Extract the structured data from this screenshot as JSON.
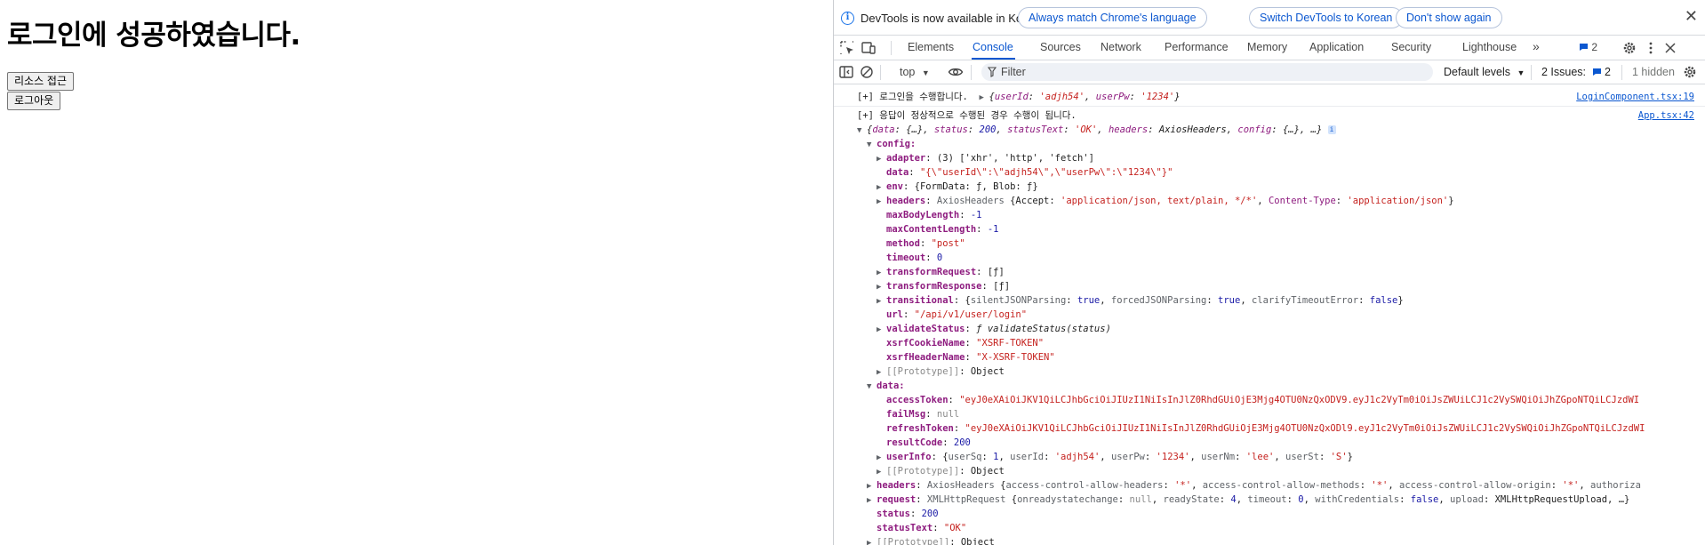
{
  "page": {
    "heading": "로그인에 성공하였습니다.",
    "resource_button": "리소스 접근",
    "logout_button": "로그아웃"
  },
  "infobar": {
    "message": "DevTools is now available in Korean!",
    "match_button": "Always match Chrome's language",
    "switch_button": "Switch DevTools to Korean",
    "dont_show_button": "Don't show again",
    "close_glyph": "✕"
  },
  "tabs": {
    "items": [
      "Elements",
      "Console",
      "Sources",
      "Network",
      "Performance",
      "Memory",
      "Application",
      "Security",
      "Lighthouse"
    ],
    "active": "Console",
    "more_glyph": "»",
    "issues_count": "2"
  },
  "filterbar": {
    "context": "top",
    "filter_placeholder": "Filter",
    "levels": "Default levels",
    "issues": "2 Issues:",
    "issues_count": "2",
    "hidden": "1 hidden"
  },
  "console": {
    "log1": {
      "prefix": "[+] 로그인을 수행합니다.",
      "obj_open": "{",
      "k1": "userId",
      "v1": "'adjh54'",
      "k2": "userPw",
      "v2": "'1234'",
      "obj_close": "}",
      "source": "LoginComponent.tsx:19"
    },
    "log2": {
      "prefix": "[+] 응답이 정상적으로 수행된 경우 수행이 됩니다.",
      "source": "App.tsx:42",
      "summary": {
        "data": "data",
        "data_v": "{…}",
        "status": "status",
        "status_v": "200",
        "statusText": "statusText",
        "statusText_v": "'OK'",
        "headers": "headers",
        "headers_v": "AxiosHeaders",
        "config": "config",
        "config_v": "{…}",
        "ellipsis": "…"
      },
      "config": {
        "label": "config:",
        "adapter_k": "adapter",
        "adapter_v": "(3) ['xhr', 'http', 'fetch']",
        "data_k": "data",
        "data_v": "\"{\\\"userId\\\":\\\"adjh54\\\",\\\"userPw\\\":\\\"1234\\\"}\"",
        "env_k": "env",
        "env_v": "{FormData: ƒ, Blob: ƒ}",
        "headers_k": "headers",
        "headers_cls": "AxiosHeaders",
        "headers_v1": "{Accept: ",
        "headers_accept": "'application/json, text/plain, */*'",
        "headers_ct_k": "Content-Type",
        "headers_ct": "'application/json'",
        "maxBodyLength_k": "maxBodyLength",
        "maxBodyLength_v": "-1",
        "maxContentLength_k": "maxContentLength",
        "maxContentLength_v": "-1",
        "method_k": "method",
        "method_v": "\"post\"",
        "timeout_k": "timeout",
        "timeout_v": "0",
        "transformRequest_k": "transformRequest",
        "transformRequest_v": "[ƒ]",
        "transformResponse_k": "transformResponse",
        "transformResponse_v": "[ƒ]",
        "transitional_k": "transitional",
        "tr_a_k": "silentJSONParsing",
        "tr_a_v": "true",
        "tr_b_k": "forcedJSONParsing",
        "tr_b_v": "true",
        "tr_c_k": "clarifyTimeoutError",
        "tr_c_v": "false",
        "url_k": "url",
        "url_v": "\"/api/v1/user/login\"",
        "validateStatus_k": "validateStatus",
        "validateStatus_v": "ƒ validateStatus(status)",
        "xsrfCookieName_k": "xsrfCookieName",
        "xsrfCookieName_v": "\"XSRF-TOKEN\"",
        "xsrfHeaderName_k": "xsrfHeaderName",
        "xsrfHeaderName_v": "\"X-XSRF-TOKEN\"",
        "proto": "[[Prototype]]",
        "proto_v": "Object"
      },
      "data": {
        "label": "data:",
        "accessToken_k": "accessToken",
        "accessToken_v": "\"eyJ0eXAiOiJKV1QiLCJhbGciOiJIUzI1NiIsInJlZ0RhdGUiOjE3Mjg4OTU0NzQxODV9.eyJ1c2VyTm0iOiJsZWUiLCJ1c2VySWQiOiJhZGpoNTQiLCJzdWI",
        "failMsg_k": "failMsg",
        "failMsg_v": "null",
        "refreshToken_k": "refreshToken",
        "refreshToken_v": "\"eyJ0eXAiOiJKV1QiLCJhbGciOiJIUzI1NiIsInJlZ0RhdGUiOjE3Mjg4OTU0NzQxODl9.eyJ1c2VyTm0iOiJsZWUiLCJ1c2VySWQiOiJhZGpoNTQiLCJzdWI",
        "resultCode_k": "resultCode",
        "resultCode_v": "200",
        "userInfo_k": "userInfo",
        "ui_a_k": "userSq",
        "ui_a_v": "1",
        "ui_b_k": "userId",
        "ui_b_v": "'adjh54'",
        "ui_c_k": "userPw",
        "ui_c_v": "'1234'",
        "ui_d_k": "userNm",
        "ui_d_v": "'lee'",
        "ui_e_k": "userSt",
        "ui_e_v": "'S'",
        "proto": "[[Prototype]]",
        "proto_v": "Object"
      },
      "tail": {
        "headers_k": "headers",
        "headers_cls": "AxiosHeaders",
        "h_a_k": "access-control-allow-headers",
        "h_a_v": "'*'",
        "h_b_k": "access-control-allow-methods",
        "h_b_v": "'*'",
        "h_c_k": "access-control-allow-origin",
        "h_c_v": "'*'",
        "h_d_k": "authoriza",
        "request_k": "request",
        "request_cls": "XMLHttpRequest",
        "r_a_k": "onreadystatechange",
        "r_a_v": "null",
        "r_b_k": "readyState",
        "r_b_v": "4",
        "r_c_k": "timeout",
        "r_c_v": "0",
        "r_d_k": "withCredentials",
        "r_d_v": "false",
        "r_e_k": "upload",
        "r_e_v": "XMLHttpRequestUpload",
        "r_more": "…}",
        "status_k": "status",
        "status_v": "200",
        "statusText_k": "statusText",
        "statusText_v": "\"OK\"",
        "proto": "[[Prototype]]",
        "proto_v": "Object"
      }
    }
  },
  "colors": {
    "accent": "#0b57d0",
    "key": "#8e1c7f",
    "string": "#c5221f",
    "number": "#1a1aa6"
  }
}
